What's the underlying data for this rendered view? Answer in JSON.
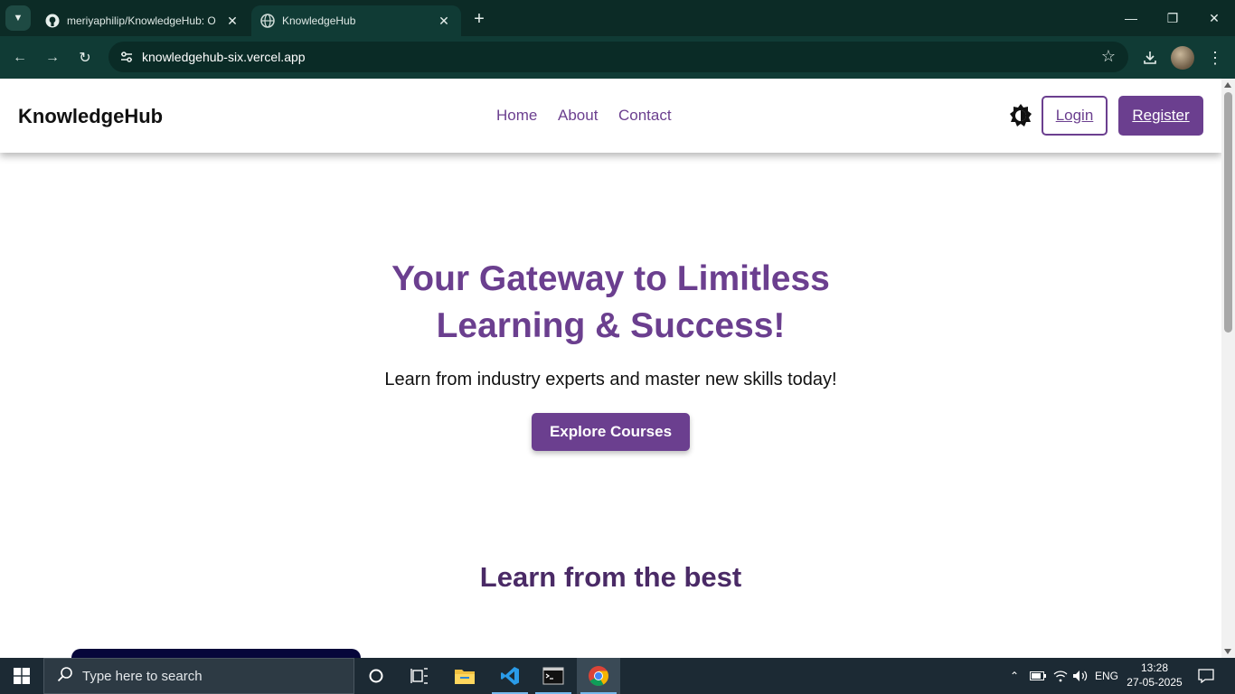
{
  "browser": {
    "tabs": [
      {
        "title": "meriyaphilip/KnowledgeHub: O",
        "active": false
      },
      {
        "title": "KnowledgeHub",
        "active": true
      }
    ],
    "url": "knowledgehub-six.vercel.app"
  },
  "navbar": {
    "brand": "KnowledgeHub",
    "links": [
      "Home",
      "About",
      "Contact"
    ],
    "login_label": "Login",
    "register_label": "Register",
    "accent_color": "#6b3f8f"
  },
  "hero": {
    "title_line1": "Your Gateway to Limitless",
    "title_line2": "Learning & Success!",
    "subtitle": "Learn from industry experts and master new skills today!",
    "cta_label": "Explore Courses"
  },
  "section": {
    "title": "Learn from the best"
  },
  "taskbar": {
    "search_placeholder": "Type here to search",
    "language": "ENG",
    "time": "13:28",
    "date": "27-05-2025"
  }
}
